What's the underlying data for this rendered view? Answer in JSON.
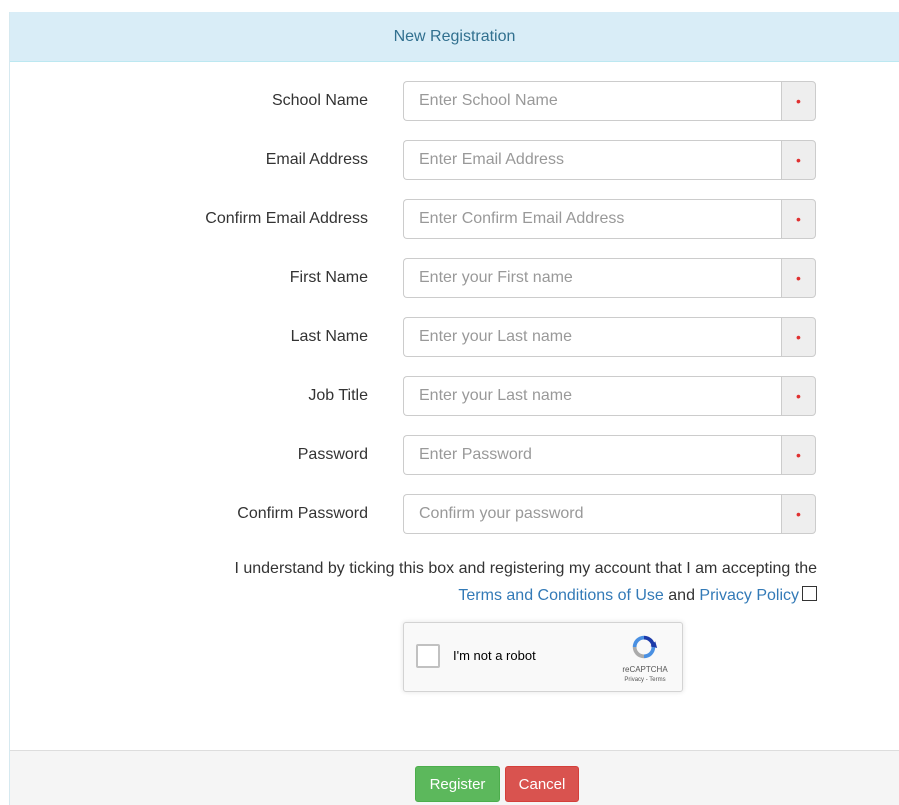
{
  "panel": {
    "title": "New Registration"
  },
  "fields": [
    {
      "label": "School Name",
      "placeholder": "Enter School Name",
      "value": "",
      "required_marker": "•"
    },
    {
      "label": "Email Address",
      "placeholder": "Enter Email Address",
      "value": "",
      "required_marker": "•"
    },
    {
      "label": "Confirm Email Address",
      "placeholder": "Enter Confirm Email Address",
      "value": "",
      "required_marker": "•"
    },
    {
      "label": "First Name",
      "placeholder": "Enter your First name",
      "value": "",
      "required_marker": "•"
    },
    {
      "label": "Last Name",
      "placeholder": "Enter your Last name",
      "value": "",
      "required_marker": "•"
    },
    {
      "label": "Job Title",
      "placeholder": "Enter your Last name",
      "value": "",
      "required_marker": "•"
    },
    {
      "label": "Password",
      "placeholder": "Enter Password",
      "value": "",
      "required_marker": "•"
    },
    {
      "label": "Confirm Password",
      "placeholder": "Confirm your password",
      "value": "",
      "required_marker": "•"
    }
  ],
  "terms": {
    "text_before": "I understand by ticking this box and registering my account that I am accepting the ",
    "terms_link": "Terms and Conditions of Use",
    "text_and": " and ",
    "privacy_link": "Privacy Policy",
    "checked": false
  },
  "captcha": {
    "label": "I'm not a robot",
    "brand": "reCAPTCHA",
    "links": "Privacy - Terms",
    "checked": false
  },
  "footer": {
    "register_label": "Register",
    "cancel_label": "Cancel"
  },
  "colors": {
    "heading_bg": "#d9edf7",
    "heading_text": "#31708f",
    "link": "#337ab7",
    "register": "#5cb85c",
    "cancel": "#d9534f",
    "required": "#e03030"
  }
}
